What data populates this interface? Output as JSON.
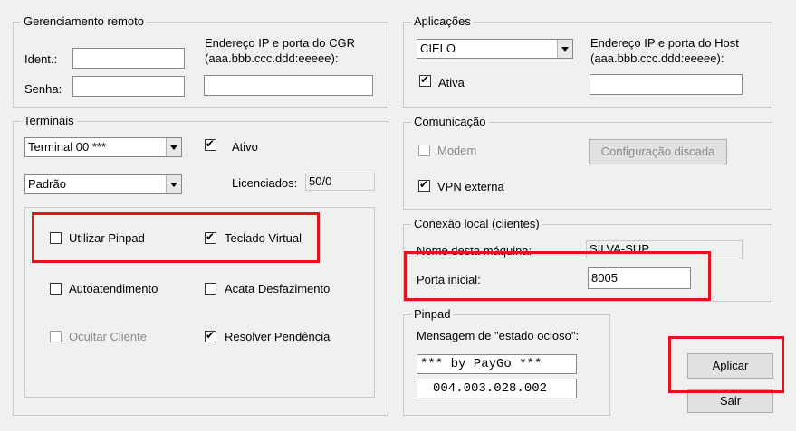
{
  "remote": {
    "legend": "Gerenciamento remoto",
    "ident_label": "Ident.:",
    "ident_value": "",
    "senha_label": "Senha:",
    "senha_value": "",
    "cgr_label_1": "Endereço IP e porta do CGR",
    "cgr_label_2": "(aaa.bbb.ccc.ddd:eeeee):",
    "cgr_value": ""
  },
  "apps": {
    "legend": "Aplicações",
    "selected": "CIELO",
    "ativa_label": "Ativa",
    "ativa_checked": true,
    "host_label_1": "Endereço IP e porta do Host",
    "host_label_2": "(aaa.bbb.ccc.ddd:eeeee):",
    "host_value": ""
  },
  "terminals": {
    "legend": "Terminais",
    "terminal_selected": "Terminal 00 ***",
    "mode_selected": "Padrão",
    "ativo_label": "Ativo",
    "ativo_checked": true,
    "licenciados_label": "Licenciados:",
    "licenciados_value": "50/0",
    "options": {
      "utilizar_pinpad": "Utilizar Pinpad",
      "teclado_virtual": "Teclado Virtual",
      "autoatendimento": "Autoatendimento",
      "acata_desfazimento": "Acata Desfazimento",
      "ocultar_cliente": "Ocultar Cliente",
      "resolver_pendencia": "Resolver Pendência"
    }
  },
  "comm": {
    "legend": "Comunicação",
    "modem_label": "Modem",
    "config_button": "Configuração discada",
    "vpn_label": "VPN externa",
    "vpn_checked": true
  },
  "local": {
    "legend": "Conexão local (clientes)",
    "machine_label": "Nome desta máquina:",
    "machine_value": "SILVA-SUP",
    "port_label": "Porta inicial:",
    "port_value": "8005"
  },
  "pinpad": {
    "legend": "Pinpad",
    "idle_label": "Mensagem de \"estado ocioso\":",
    "line1": "*** by PayGo ***",
    "line2": "004.003.028.002"
  },
  "buttons": {
    "apply": "Aplicar",
    "exit": "Sair"
  },
  "colors": {
    "highlight": "#e4131f",
    "window_bg": "#f0f0f0"
  }
}
